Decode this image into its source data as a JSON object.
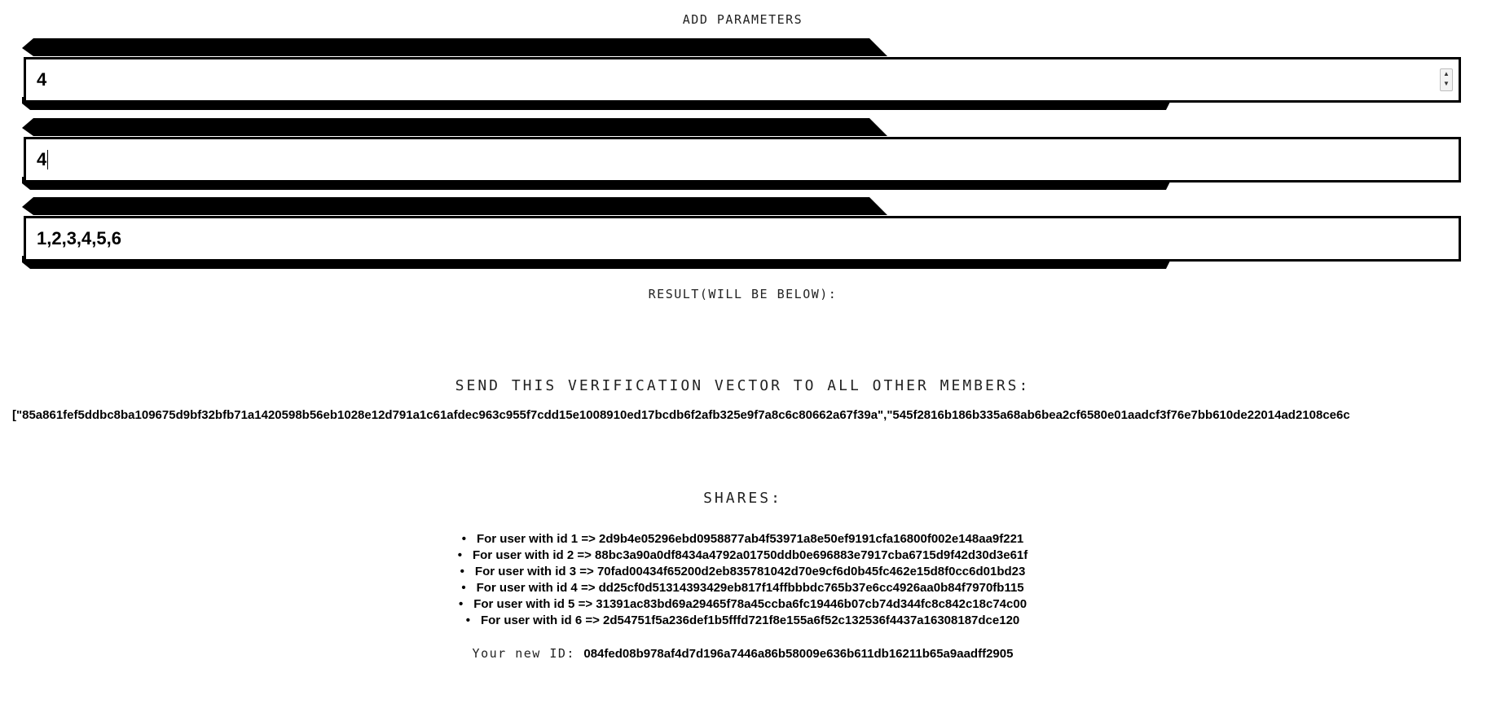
{
  "page": {
    "add_parameters_heading": "Add parameters",
    "result_heading": "Result(will be below):"
  },
  "form": {
    "fields": [
      {
        "value": "4",
        "type": "number"
      },
      {
        "value": "4",
        "type": "text",
        "focused": true
      },
      {
        "value": "1,2,3,4,5,6",
        "type": "text"
      }
    ]
  },
  "result": {
    "vector_heading": "Send this verification vector to all other members:",
    "vector_text": "[\"85a861fef5ddbc8ba109675d9bf32bfb71a1420598b56eb1028e12d791a1c61afdec963c955f7cdd15e1008910ed17bcdb6f2afb325e9f7a8c6c80662a67f39a\",\"545f2816b186b335a68ab6bea2cf6580e01aadcf3f76e7bb610de22014ad2108ce6c",
    "shares_heading": "Shares:",
    "shares": [
      "For user with id 1 => 2d9b4e05296ebd0958877ab4f53971a8e50ef9191cfa16800f002e148aa9f221",
      "For user with id 2 => 88bc3a90a0df8434a4792a01750ddb0e696883e7917cba6715d9f42d30d3e61f",
      "For user with id 3 => 70fad00434f65200d2eb835781042d70e9cf6d0b45fc462e15d8f0cc6d01bd23",
      "For user with id 4 => dd25cf0d51314393429eb817f14ffbbbdc765b37e6cc4926aa0b84f7970fb115",
      "For user with id 5 => 31391ac83bd69a29465f78a45ccba6fc19446b07cb74d344fc8c842c18c74c00",
      "For user with id 6 => 2d54751f5a236def1b5fffd721f8e155a6f52c132536f4437a16308187dce120"
    ],
    "new_id_label": "Your new ID:",
    "new_id_value": "084fed08b978af4d7d196a7446a86b58009e636b611db16211b65a9aadff2905"
  }
}
